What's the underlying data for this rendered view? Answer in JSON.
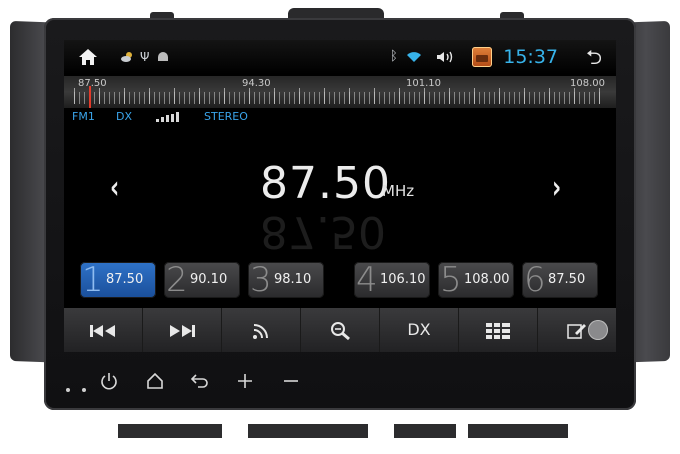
{
  "statusbar": {
    "home_icon": "home-icon",
    "weather_icon": "weather-icon",
    "usb_icon": "usb-icon",
    "android_icon": "android-icon",
    "bluetooth_icon": "bluetooth-icon",
    "wifi_icon": "wifi-icon",
    "volume_icon": "volume-icon",
    "clock": "15:37",
    "back_icon": "back-icon"
  },
  "scale": {
    "labels": [
      "87.50",
      "94.30",
      "101.10",
      "108.00"
    ]
  },
  "info": {
    "band": "FM1",
    "mode": "DX",
    "stereo": "STEREO"
  },
  "tuner": {
    "frequency": "87.50",
    "unit": "MHz",
    "prev_symbol": "‹",
    "next_symbol": "›"
  },
  "presets": [
    {
      "num": "1",
      "value": "87.50"
    },
    {
      "num": "2",
      "value": "90.10"
    },
    {
      "num": "3",
      "value": "98.10"
    },
    {
      "num": "4",
      "value": "106.10"
    },
    {
      "num": "5",
      "value": "108.00"
    },
    {
      "num": "6",
      "value": "87.50"
    }
  ],
  "toolbar": {
    "prev_icon": "seek-back-icon",
    "next_icon": "seek-forward-icon",
    "rds_icon": "signal-icon",
    "search_icon": "search-icon",
    "dx_label": "DX",
    "list_icon": "list-icon",
    "edit_icon": "edit-icon"
  },
  "colors": {
    "accent": "#37b3ea",
    "active_preset": "#2f73c8"
  }
}
